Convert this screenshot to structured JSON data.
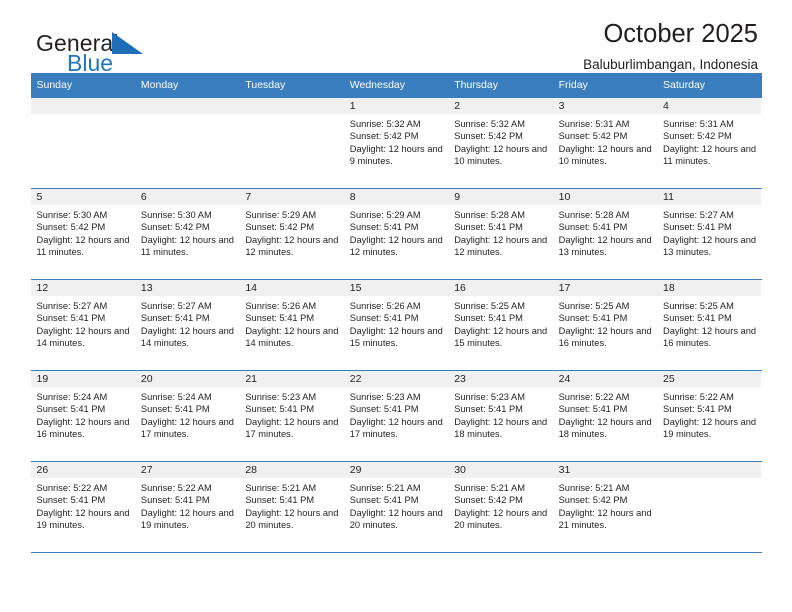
{
  "brand": {
    "name_part1": "General",
    "name_part2": "Blue",
    "logo_icon": "blue-triangle-icon",
    "accent_color": "#2176bd"
  },
  "header": {
    "title": "October 2025",
    "subtitle": "Baluburlimbangan, Indonesia"
  },
  "calendar": {
    "header_bg_color": "#3a7ebf",
    "day_band_color": "#f0f0f0",
    "weekdays": [
      "Sunday",
      "Monday",
      "Tuesday",
      "Wednesday",
      "Thursday",
      "Friday",
      "Saturday"
    ],
    "weeks": [
      [
        {
          "day": "",
          "empty": true
        },
        {
          "day": "",
          "empty": true
        },
        {
          "day": "",
          "empty": true
        },
        {
          "day": "1",
          "sunrise": "Sunrise: 5:32 AM",
          "sunset": "Sunset: 5:42 PM",
          "daylight": "Daylight: 12 hours and 9 minutes."
        },
        {
          "day": "2",
          "sunrise": "Sunrise: 5:32 AM",
          "sunset": "Sunset: 5:42 PM",
          "daylight": "Daylight: 12 hours and 10 minutes."
        },
        {
          "day": "3",
          "sunrise": "Sunrise: 5:31 AM",
          "sunset": "Sunset: 5:42 PM",
          "daylight": "Daylight: 12 hours and 10 minutes."
        },
        {
          "day": "4",
          "sunrise": "Sunrise: 5:31 AM",
          "sunset": "Sunset: 5:42 PM",
          "daylight": "Daylight: 12 hours and 11 minutes."
        }
      ],
      [
        {
          "day": "5",
          "sunrise": "Sunrise: 5:30 AM",
          "sunset": "Sunset: 5:42 PM",
          "daylight": "Daylight: 12 hours and 11 minutes."
        },
        {
          "day": "6",
          "sunrise": "Sunrise: 5:30 AM",
          "sunset": "Sunset: 5:42 PM",
          "daylight": "Daylight: 12 hours and 11 minutes."
        },
        {
          "day": "7",
          "sunrise": "Sunrise: 5:29 AM",
          "sunset": "Sunset: 5:42 PM",
          "daylight": "Daylight: 12 hours and 12 minutes."
        },
        {
          "day": "8",
          "sunrise": "Sunrise: 5:29 AM",
          "sunset": "Sunset: 5:41 PM",
          "daylight": "Daylight: 12 hours and 12 minutes."
        },
        {
          "day": "9",
          "sunrise": "Sunrise: 5:28 AM",
          "sunset": "Sunset: 5:41 PM",
          "daylight": "Daylight: 12 hours and 12 minutes."
        },
        {
          "day": "10",
          "sunrise": "Sunrise: 5:28 AM",
          "sunset": "Sunset: 5:41 PM",
          "daylight": "Daylight: 12 hours and 13 minutes."
        },
        {
          "day": "11",
          "sunrise": "Sunrise: 5:27 AM",
          "sunset": "Sunset: 5:41 PM",
          "daylight": "Daylight: 12 hours and 13 minutes."
        }
      ],
      [
        {
          "day": "12",
          "sunrise": "Sunrise: 5:27 AM",
          "sunset": "Sunset: 5:41 PM",
          "daylight": "Daylight: 12 hours and 14 minutes."
        },
        {
          "day": "13",
          "sunrise": "Sunrise: 5:27 AM",
          "sunset": "Sunset: 5:41 PM",
          "daylight": "Daylight: 12 hours and 14 minutes."
        },
        {
          "day": "14",
          "sunrise": "Sunrise: 5:26 AM",
          "sunset": "Sunset: 5:41 PM",
          "daylight": "Daylight: 12 hours and 14 minutes."
        },
        {
          "day": "15",
          "sunrise": "Sunrise: 5:26 AM",
          "sunset": "Sunset: 5:41 PM",
          "daylight": "Daylight: 12 hours and 15 minutes."
        },
        {
          "day": "16",
          "sunrise": "Sunrise: 5:25 AM",
          "sunset": "Sunset: 5:41 PM",
          "daylight": "Daylight: 12 hours and 15 minutes."
        },
        {
          "day": "17",
          "sunrise": "Sunrise: 5:25 AM",
          "sunset": "Sunset: 5:41 PM",
          "daylight": "Daylight: 12 hours and 16 minutes."
        },
        {
          "day": "18",
          "sunrise": "Sunrise: 5:25 AM",
          "sunset": "Sunset: 5:41 PM",
          "daylight": "Daylight: 12 hours and 16 minutes."
        }
      ],
      [
        {
          "day": "19",
          "sunrise": "Sunrise: 5:24 AM",
          "sunset": "Sunset: 5:41 PM",
          "daylight": "Daylight: 12 hours and 16 minutes."
        },
        {
          "day": "20",
          "sunrise": "Sunrise: 5:24 AM",
          "sunset": "Sunset: 5:41 PM",
          "daylight": "Daylight: 12 hours and 17 minutes."
        },
        {
          "day": "21",
          "sunrise": "Sunrise: 5:23 AM",
          "sunset": "Sunset: 5:41 PM",
          "daylight": "Daylight: 12 hours and 17 minutes."
        },
        {
          "day": "22",
          "sunrise": "Sunrise: 5:23 AM",
          "sunset": "Sunset: 5:41 PM",
          "daylight": "Daylight: 12 hours and 17 minutes."
        },
        {
          "day": "23",
          "sunrise": "Sunrise: 5:23 AM",
          "sunset": "Sunset: 5:41 PM",
          "daylight": "Daylight: 12 hours and 18 minutes."
        },
        {
          "day": "24",
          "sunrise": "Sunrise: 5:22 AM",
          "sunset": "Sunset: 5:41 PM",
          "daylight": "Daylight: 12 hours and 18 minutes."
        },
        {
          "day": "25",
          "sunrise": "Sunrise: 5:22 AM",
          "sunset": "Sunset: 5:41 PM",
          "daylight": "Daylight: 12 hours and 19 minutes."
        }
      ],
      [
        {
          "day": "26",
          "sunrise": "Sunrise: 5:22 AM",
          "sunset": "Sunset: 5:41 PM",
          "daylight": "Daylight: 12 hours and 19 minutes."
        },
        {
          "day": "27",
          "sunrise": "Sunrise: 5:22 AM",
          "sunset": "Sunset: 5:41 PM",
          "daylight": "Daylight: 12 hours and 19 minutes."
        },
        {
          "day": "28",
          "sunrise": "Sunrise: 5:21 AM",
          "sunset": "Sunset: 5:41 PM",
          "daylight": "Daylight: 12 hours and 20 minutes."
        },
        {
          "day": "29",
          "sunrise": "Sunrise: 5:21 AM",
          "sunset": "Sunset: 5:41 PM",
          "daylight": "Daylight: 12 hours and 20 minutes."
        },
        {
          "day": "30",
          "sunrise": "Sunrise: 5:21 AM",
          "sunset": "Sunset: 5:42 PM",
          "daylight": "Daylight: 12 hours and 20 minutes."
        },
        {
          "day": "31",
          "sunrise": "Sunrise: 5:21 AM",
          "sunset": "Sunset: 5:42 PM",
          "daylight": "Daylight: 12 hours and 21 minutes."
        },
        {
          "day": "",
          "empty": true
        }
      ]
    ]
  }
}
